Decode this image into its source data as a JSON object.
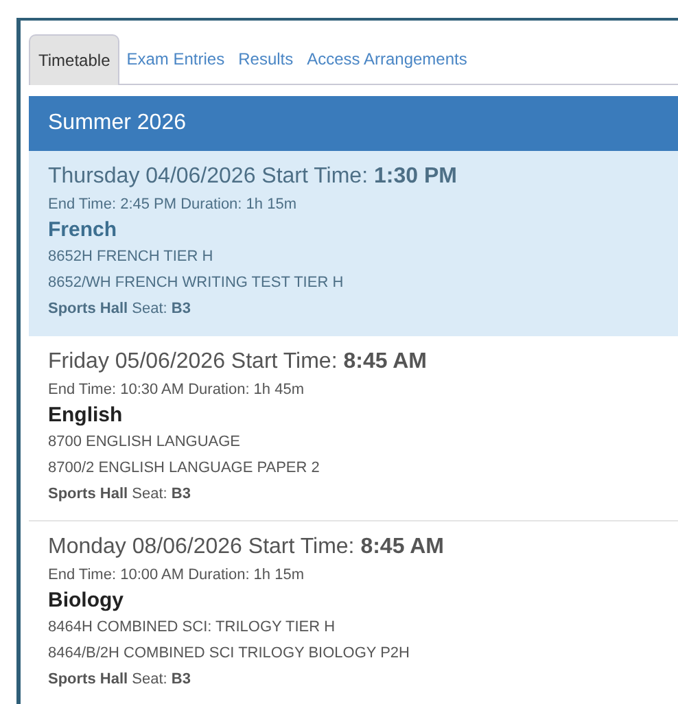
{
  "tabs": [
    {
      "label": "Timetable",
      "selected": true
    },
    {
      "label": "Exam Entries",
      "selected": false
    },
    {
      "label": "Results",
      "selected": false
    },
    {
      "label": "Access Arrangements",
      "selected": false
    }
  ],
  "series": {
    "title": "Summer 2026",
    "exams": [
      {
        "selected": true,
        "start": "Thursday 04/06/2026 Start Time: **1:30 PM**",
        "end": "End Time: 2:45 PM Duration: 1h 15m",
        "subject": "French",
        "components": [
          "8652H FRENCH TIER H",
          "8652/WH FRENCH WRITING TEST TIER H"
        ],
        "room": "**Sports Hall** Seat: **B3**"
      },
      {
        "selected": false,
        "start": "Friday 05/06/2026 Start Time: **8:45 AM**",
        "end": "End Time: 10:30 AM Duration: 1h 45m",
        "subject": "English",
        "components": [
          "8700 ENGLISH LANGUAGE",
          "8700/2 ENGLISH LANGUAGE PAPER 2"
        ],
        "room": "**Sports Hall** Seat: **B3**"
      },
      {
        "selected": false,
        "start": "Monday 08/06/2026 Start Time: **8:45 AM**",
        "end": "End Time: 10:00 AM Duration: 1h 15m",
        "subject": "Biology",
        "components": [
          "8464H COMBINED SCI: TRILOGY TIER H",
          "8464/B/2H COMBINED SCI TRILOGY BIOLOGY P2H"
        ],
        "room": "**Sports Hall** Seat: **B3**"
      }
    ]
  }
}
